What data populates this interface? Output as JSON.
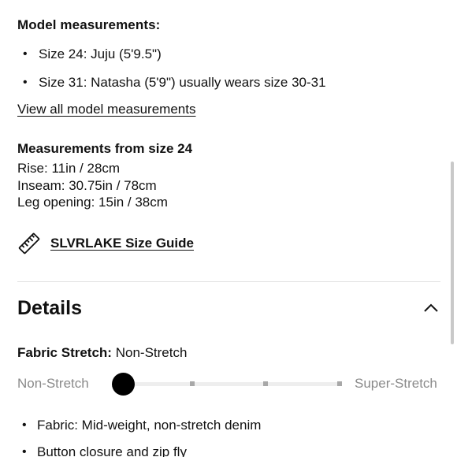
{
  "model": {
    "heading": "Model measurements:",
    "items": [
      "Size 24: Juju (5'9.5\")",
      "Size 31: Natasha (5'9\") usually wears size 30-31"
    ],
    "view_all_link": "View all model measurements"
  },
  "measurements": {
    "heading": "Measurements from size 24",
    "rise": "Rise: 11in / 28cm",
    "inseam": "Inseam: 30.75in / 78cm",
    "leg_opening": "Leg opening: 15in / 38cm"
  },
  "size_guide": {
    "icon": "ruler-icon",
    "label": "SLVRLAKE Size Guide"
  },
  "details": {
    "title": "Details",
    "toggle_icon": "chevron-up-icon",
    "stretch_label": "Fabric Stretch:",
    "stretch_value": "Non-Stretch",
    "scale": {
      "min_label": "Non-Stretch",
      "max_label": "Super-Stretch",
      "steps": 4,
      "selected_index": 0,
      "knob_color": "#000000",
      "track_color": "#eeeeee"
    },
    "bullets": [
      "Fabric: Mid-weight, non-stretch denim",
      "Button closure and zip fly"
    ]
  }
}
